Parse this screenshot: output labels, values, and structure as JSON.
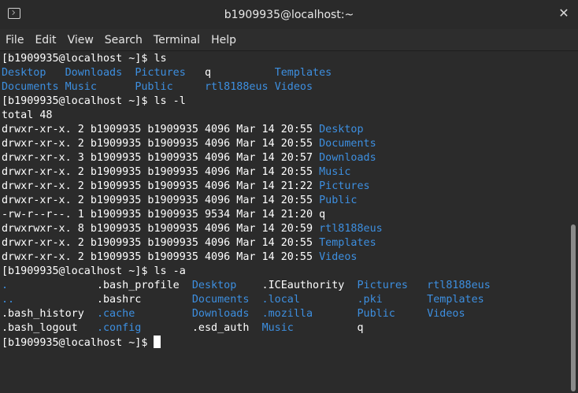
{
  "window": {
    "title": "b1909935@localhost:~",
    "close_glyph": "✕"
  },
  "menu": [
    "File",
    "Edit",
    "View",
    "Search",
    "Terminal",
    "Help"
  ],
  "colors": {
    "background": "#2b2b2b",
    "text": "#ffffff",
    "directory": "#3d8fe0"
  },
  "terminal": {
    "lines": [
      [
        {
          "t": "[b1909935@localhost ~]$ ls"
        }
      ],
      [
        {
          "t": "Desktop",
          "c": "dir"
        },
        {
          "t": "   "
        },
        {
          "t": "Downloads",
          "c": "dir"
        },
        {
          "t": "  "
        },
        {
          "t": "Pictures",
          "c": "dir"
        },
        {
          "t": "   q          "
        },
        {
          "t": "Templates",
          "c": "dir"
        }
      ],
      [
        {
          "t": "Documents",
          "c": "dir"
        },
        {
          "t": " "
        },
        {
          "t": "Music",
          "c": "dir"
        },
        {
          "t": "      "
        },
        {
          "t": "Public",
          "c": "dir"
        },
        {
          "t": "     "
        },
        {
          "t": "rtl8188eus",
          "c": "dir"
        },
        {
          "t": " "
        },
        {
          "t": "Videos",
          "c": "dir"
        }
      ],
      [
        {
          "t": "[b1909935@localhost ~]$ ls -l"
        }
      ],
      [
        {
          "t": "total 48"
        }
      ],
      [
        {
          "t": "drwxr-xr-x. 2 b1909935 b1909935 4096 Mar 14 20:55 "
        },
        {
          "t": "Desktop",
          "c": "dir"
        }
      ],
      [
        {
          "t": "drwxr-xr-x. 2 b1909935 b1909935 4096 Mar 14 20:55 "
        },
        {
          "t": "Documents",
          "c": "dir"
        }
      ],
      [
        {
          "t": "drwxr-xr-x. 3 b1909935 b1909935 4096 Mar 14 20:57 "
        },
        {
          "t": "Downloads",
          "c": "dir"
        }
      ],
      [
        {
          "t": "drwxr-xr-x. 2 b1909935 b1909935 4096 Mar 14 20:55 "
        },
        {
          "t": "Music",
          "c": "dir"
        }
      ],
      [
        {
          "t": "drwxr-xr-x. 2 b1909935 b1909935 4096 Mar 14 21:22 "
        },
        {
          "t": "Pictures",
          "c": "dir"
        }
      ],
      [
        {
          "t": "drwxr-xr-x. 2 b1909935 b1909935 4096 Mar 14 20:55 "
        },
        {
          "t": "Public",
          "c": "dir"
        }
      ],
      [
        {
          "t": "-rw-r--r--. 1 b1909935 b1909935 9534 Mar 14 21:20 q"
        }
      ],
      [
        {
          "t": "drwxrwxr-x. 8 b1909935 b1909935 4096 Mar 14 20:59 "
        },
        {
          "t": "rtl8188eus",
          "c": "dir"
        }
      ],
      [
        {
          "t": "drwxr-xr-x. 2 b1909935 b1909935 4096 Mar 14 20:55 "
        },
        {
          "t": "Templates",
          "c": "dir"
        }
      ],
      [
        {
          "t": "drwxr-xr-x. 2 b1909935 b1909935 4096 Mar 14 20:55 "
        },
        {
          "t": "Videos",
          "c": "dir"
        }
      ],
      [
        {
          "t": "[b1909935@localhost ~]$ ls -a"
        }
      ],
      [
        {
          "t": ".",
          "c": "dir"
        },
        {
          "t": "              .bash_profile  "
        },
        {
          "t": "Desktop",
          "c": "dir"
        },
        {
          "t": "    .ICEauthority  "
        },
        {
          "t": "Pictures",
          "c": "dir"
        },
        {
          "t": "   "
        },
        {
          "t": "rtl8188eus",
          "c": "dir"
        }
      ],
      [
        {
          "t": "..",
          "c": "dir"
        },
        {
          "t": "             .bashrc        "
        },
        {
          "t": "Documents",
          "c": "dir"
        },
        {
          "t": "  "
        },
        {
          "t": ".local",
          "c": "dir"
        },
        {
          "t": "         "
        },
        {
          "t": ".pki",
          "c": "dir"
        },
        {
          "t": "       "
        },
        {
          "t": "Templates",
          "c": "dir"
        }
      ],
      [
        {
          "t": ".bash_history  "
        },
        {
          "t": ".cache",
          "c": "dir"
        },
        {
          "t": "         "
        },
        {
          "t": "Downloads",
          "c": "dir"
        },
        {
          "t": "  "
        },
        {
          "t": ".mozilla",
          "c": "dir"
        },
        {
          "t": "       "
        },
        {
          "t": "Public",
          "c": "dir"
        },
        {
          "t": "     "
        },
        {
          "t": "Videos",
          "c": "dir"
        }
      ],
      [
        {
          "t": ".bash_logout   "
        },
        {
          "t": ".config",
          "c": "dir"
        },
        {
          "t": "        .esd_auth  "
        },
        {
          "t": "Music",
          "c": "dir"
        },
        {
          "t": "          q"
        }
      ]
    ],
    "prompt": "[b1909935@localhost ~]$ "
  }
}
